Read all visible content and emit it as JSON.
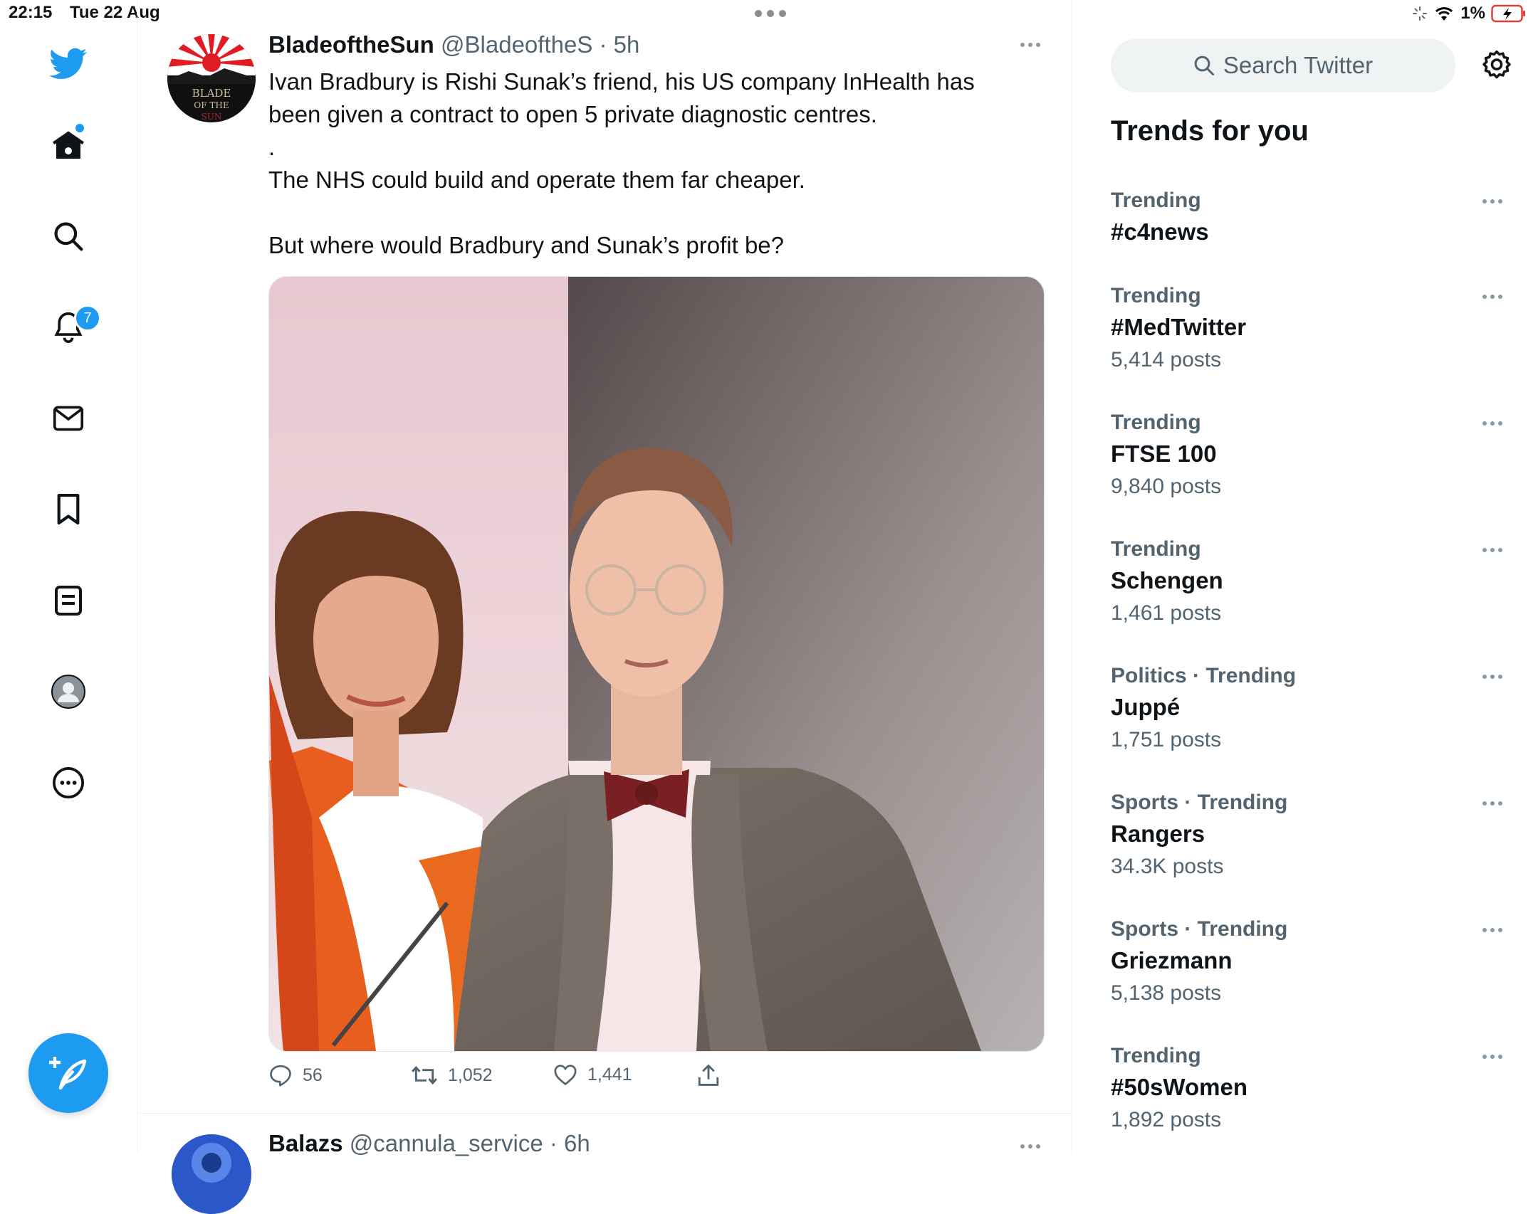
{
  "status": {
    "time": "22:15",
    "date": "Tue 22 Aug",
    "battery": "1%"
  },
  "sidebar": {
    "items": [
      {
        "icon": "twitter-logo-icon"
      },
      {
        "icon": "home-icon"
      },
      {
        "icon": "explore-search-icon"
      },
      {
        "icon": "notifications-bell-icon",
        "badge": "7"
      },
      {
        "icon": "messages-envelope-icon"
      },
      {
        "icon": "bookmark-icon"
      },
      {
        "icon": "lists-icon"
      },
      {
        "icon": "profile-avatar-icon"
      },
      {
        "icon": "more-circle-icon"
      }
    ],
    "compose_icon": "compose-feather-icon"
  },
  "feed": {
    "tweet": {
      "author_name": "BladeoftheSun",
      "meta": "@BladeoftheS · 5h",
      "avatar_text": "BLADE OF THE SUN",
      "text": "Ivan Bradbury is Rishi Sunak’s friend, his US company InHealth has been given a contract to open 5 private diagnostic centres.\n.\nThe NHS could build and operate them far cheaper.\n\nBut where would Bradbury and Sunak’s profit be?",
      "actions": {
        "replies": "56",
        "retweets": "1,052",
        "likes": "1,441"
      }
    },
    "next_tweet": {
      "author_name": "Balazs",
      "meta": "@cannula_service · 6h"
    }
  },
  "right_panel": {
    "search_placeholder": "Search Twitter",
    "trends_title": "Trends for you",
    "trends": [
      {
        "context": "Trending",
        "name": "#c4news",
        "count": ""
      },
      {
        "context": "Trending",
        "name": "#MedTwitter",
        "count": "5,414 posts"
      },
      {
        "context": "Trending",
        "name": "FTSE 100",
        "count": "9,840 posts"
      },
      {
        "context": "Trending",
        "name": "Schengen",
        "count": "1,461 posts"
      },
      {
        "context": "Politics · Trending",
        "name": "Juppé",
        "count": "1,751 posts"
      },
      {
        "context": "Sports · Trending",
        "name": "Rangers",
        "count": "34.3K posts"
      },
      {
        "context": "Sports · Trending",
        "name": "Griezmann",
        "count": "5,138 posts"
      },
      {
        "context": "Trending",
        "name": "#50sWomen",
        "count": "1,892 posts"
      }
    ]
  },
  "colors": {
    "accent": "#1d9bf0",
    "text": "#0f1419",
    "secondary": "#536471"
  }
}
